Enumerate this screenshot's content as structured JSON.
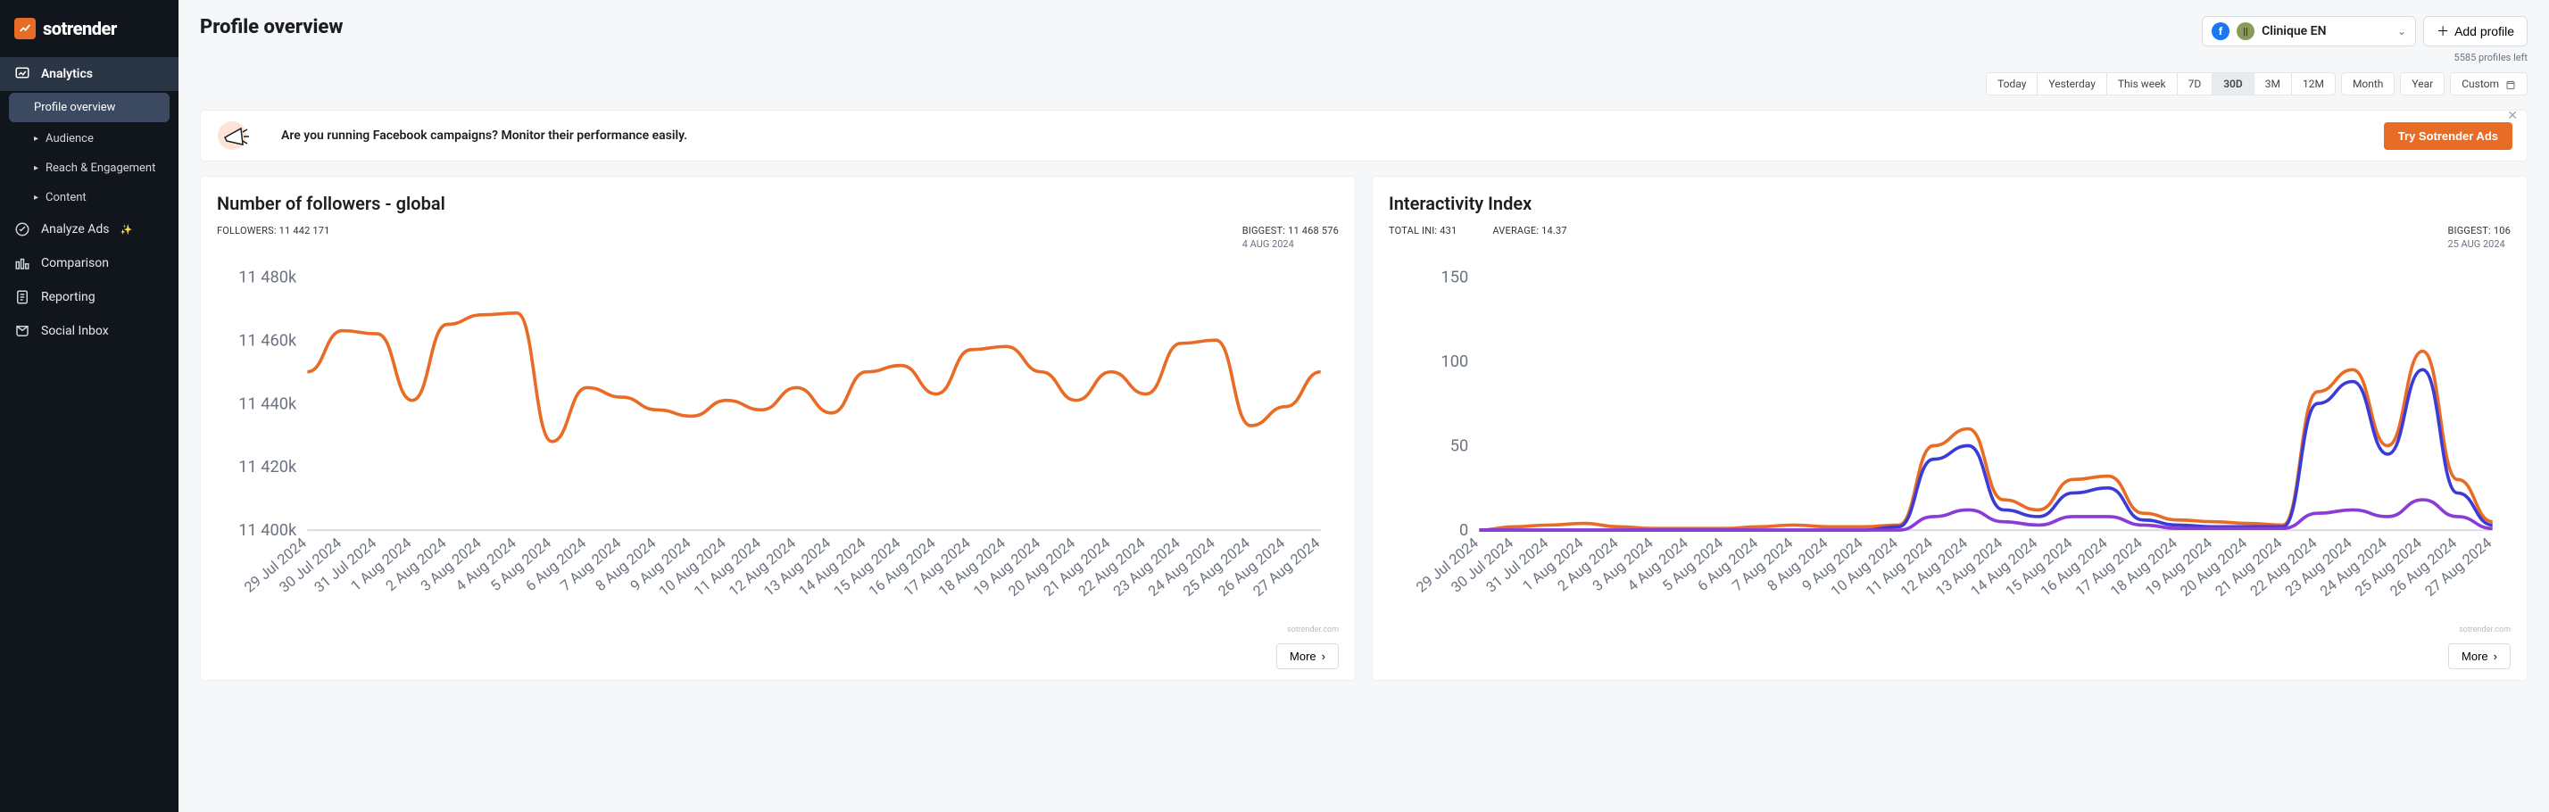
{
  "logo_text": "sotrender",
  "nav": {
    "analytics": "Analytics",
    "profile_overview": "Profile overview",
    "audience": "Audience",
    "reach": "Reach & Engagement",
    "content": "Content",
    "analyze_ads": "Analyze Ads",
    "comparison": "Comparison",
    "reporting": "Reporting",
    "social_inbox": "Social Inbox"
  },
  "page_title": "Profile overview",
  "profile_select": {
    "name": "Clinique EN"
  },
  "add_profile": "Add profile",
  "profiles_left": "5585 profiles left",
  "ranges": {
    "today": "Today",
    "yesterday": "Yesterday",
    "thisweek": "This week",
    "d7": "7D",
    "d30": "30D",
    "m3": "3M",
    "m12": "12M",
    "month": "Month",
    "year": "Year",
    "custom": "Custom"
  },
  "banner": {
    "text": "Are you running Facebook campaigns? Monitor their performance easily.",
    "cta": "Try Sotrender Ads"
  },
  "card1": {
    "title": "Number of followers - global",
    "followers_label": "FOLLOWERS: 11 442 171",
    "biggest_label": "BIGGEST: 11 468 576",
    "biggest_date": "4 AUG 2024"
  },
  "card2": {
    "title": "Interactivity Index",
    "total_label": "TOTAL INI: 431",
    "avg_label": "AVERAGE: 14.37",
    "biggest_label": "BIGGEST: 106",
    "biggest_date": "25 AUG 2024"
  },
  "more": "More",
  "watermark": "sotrender.com",
  "chart_data": [
    {
      "type": "line",
      "title": "Number of followers - global",
      "xlabel": "",
      "ylabel": "",
      "ylim": [
        11400000,
        11480000
      ],
      "yticks": [
        "11 400k",
        "11 420k",
        "11 440k",
        "11 460k",
        "11 480k"
      ],
      "categories": [
        "29 Jul 2024",
        "30 Jul 2024",
        "31 Jul 2024",
        "1 Aug 2024",
        "2 Aug 2024",
        "3 Aug 2024",
        "4 Aug 2024",
        "5 Aug 2024",
        "6 Aug 2024",
        "7 Aug 2024",
        "8 Aug 2024",
        "9 Aug 2024",
        "10 Aug 2024",
        "11 Aug 2024",
        "12 Aug 2024",
        "13 Aug 2024",
        "14 Aug 2024",
        "15 Aug 2024",
        "16 Aug 2024",
        "17 Aug 2024",
        "18 Aug 2024",
        "19 Aug 2024",
        "20 Aug 2024",
        "21 Aug 2024",
        "22 Aug 2024",
        "23 Aug 2024",
        "24 Aug 2024",
        "25 Aug 2024",
        "26 Aug 2024",
        "27 Aug 2024"
      ],
      "series": [
        {
          "name": "followers",
          "color": "#e86c25",
          "values": [
            11450000,
            11463000,
            11462000,
            11441000,
            11465000,
            11468000,
            11468576,
            11428000,
            11445000,
            11442000,
            11438000,
            11436000,
            11441000,
            11438000,
            11445000,
            11437000,
            11450000,
            11452000,
            11443000,
            11457000,
            11458000,
            11450000,
            11441000,
            11450000,
            11443000,
            11459000,
            11460000,
            11433000,
            11439000,
            11450000
          ]
        }
      ]
    },
    {
      "type": "line",
      "title": "Interactivity Index",
      "xlabel": "",
      "ylabel": "",
      "ylim": [
        0,
        150
      ],
      "yticks": [
        "0",
        "50",
        "100",
        "150"
      ],
      "categories": [
        "29 Jul 2024",
        "30 Jul 2024",
        "31 Jul 2024",
        "1 Aug 2024",
        "2 Aug 2024",
        "3 Aug 2024",
        "4 Aug 2024",
        "5 Aug 2024",
        "6 Aug 2024",
        "7 Aug 2024",
        "8 Aug 2024",
        "9 Aug 2024",
        "10 Aug 2024",
        "11 Aug 2024",
        "12 Aug 2024",
        "13 Aug 2024",
        "14 Aug 2024",
        "15 Aug 2024",
        "16 Aug 2024",
        "17 Aug 2024",
        "18 Aug 2024",
        "19 Aug 2024",
        "20 Aug 2024",
        "21 Aug 2024",
        "22 Aug 2024",
        "23 Aug 2024",
        "24 Aug 2024",
        "25 Aug 2024",
        "26 Aug 2024",
        "27 Aug 2024"
      ],
      "series": [
        {
          "name": "orange",
          "color": "#e86c25",
          "values": [
            0,
            2,
            3,
            4,
            2,
            1,
            1,
            1,
            2,
            3,
            2,
            2,
            3,
            50,
            60,
            18,
            12,
            30,
            32,
            10,
            6,
            5,
            4,
            3,
            82,
            95,
            50,
            106,
            30,
            5
          ]
        },
        {
          "name": "blue",
          "color": "#3b3bd6",
          "values": [
            0,
            0,
            0,
            0,
            0,
            0,
            0,
            0,
            0,
            0,
            0,
            0,
            2,
            42,
            50,
            12,
            8,
            22,
            25,
            6,
            3,
            2,
            2,
            2,
            75,
            88,
            45,
            95,
            22,
            3
          ]
        },
        {
          "name": "purple",
          "color": "#8b3bd6",
          "values": [
            0,
            0,
            0,
            0,
            0,
            0,
            0,
            0,
            0,
            0,
            0,
            0,
            0,
            8,
            12,
            5,
            3,
            8,
            8,
            3,
            1,
            1,
            1,
            1,
            10,
            12,
            8,
            18,
            8,
            1
          ]
        }
      ]
    }
  ]
}
